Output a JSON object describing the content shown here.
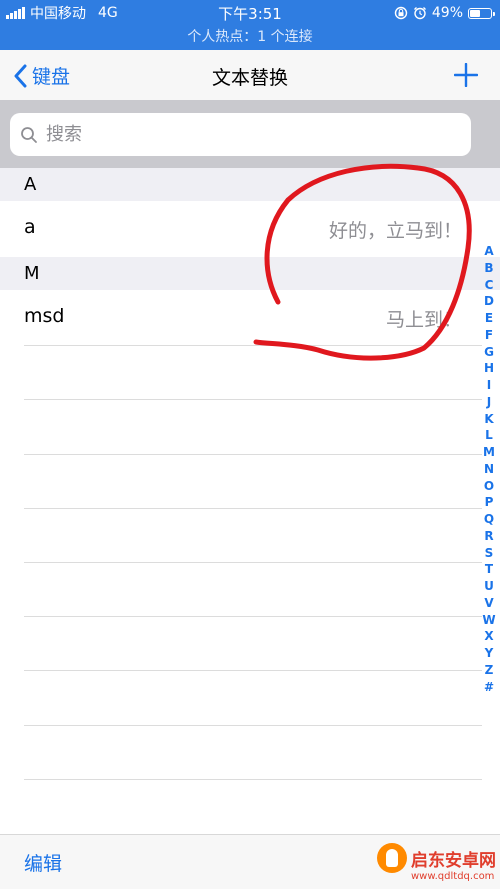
{
  "status_bar": {
    "carrier": "中国移动",
    "network": "4G",
    "time": "下午3:51",
    "battery_percent": "49%",
    "battery_level": 0.49,
    "hotspot_text": "个人热点：1 个连接"
  },
  "nav": {
    "back_label": "键盘",
    "title": "文本替换",
    "add_icon": "plus-icon"
  },
  "search": {
    "placeholder": "搜索"
  },
  "sections": [
    {
      "header": "A",
      "rows": [
        {
          "shortcut": "a",
          "phrase": "好的，立马到！"
        }
      ]
    },
    {
      "header": "M",
      "rows": [
        {
          "shortcut": "msd",
          "phrase": "马上到！"
        }
      ]
    }
  ],
  "index_letters": [
    "A",
    "B",
    "C",
    "D",
    "E",
    "F",
    "G",
    "H",
    "I",
    "J",
    "K",
    "L",
    "M",
    "N",
    "O",
    "P",
    "Q",
    "R",
    "S",
    "T",
    "U",
    "V",
    "W",
    "X",
    "Y",
    "Z",
    "#"
  ],
  "bottom": {
    "edit_label": "编辑"
  },
  "watermark": {
    "name": "启东安卓网",
    "url": "www.qdltdq.com"
  },
  "colors": {
    "status_bar": "#2f7de1",
    "accent": "#1a73e8",
    "annotation": "#e0181e"
  }
}
